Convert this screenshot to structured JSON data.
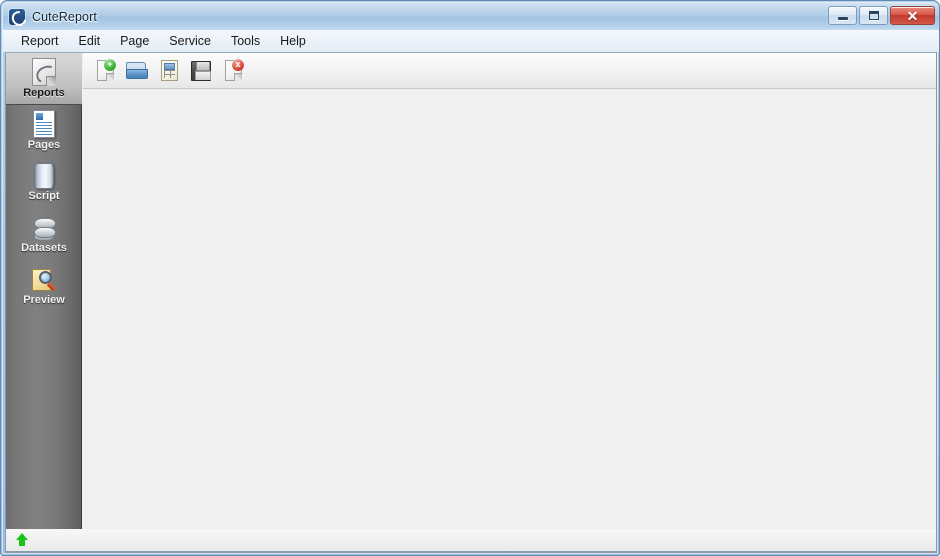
{
  "window": {
    "title": "CuteReport",
    "app_icon": "cutereport-logo-icon",
    "controls": {
      "minimize_label": "",
      "maximize_label": "",
      "close_label": "✕"
    }
  },
  "menu": {
    "items": [
      {
        "label": "Report"
      },
      {
        "label": "Edit"
      },
      {
        "label": "Page"
      },
      {
        "label": "Service"
      },
      {
        "label": "Tools"
      },
      {
        "label": "Help"
      }
    ]
  },
  "toolbar": {
    "buttons": [
      {
        "name": "new-report-button",
        "icon": "new-document-icon",
        "badge": "+"
      },
      {
        "name": "open-report-button",
        "icon": "open-folder-icon",
        "badge": ""
      },
      {
        "name": "save-as-report-button",
        "icon": "report-table-icon",
        "badge": ""
      },
      {
        "name": "save-report-button",
        "icon": "floppy-save-icon",
        "badge": ""
      },
      {
        "name": "close-report-button",
        "icon": "close-document-icon",
        "badge": "x"
      }
    ]
  },
  "sidebar": {
    "items": [
      {
        "label": "Reports",
        "icon": "reports-icon",
        "selected": true
      },
      {
        "label": "Pages",
        "icon": "pages-icon",
        "selected": false
      },
      {
        "label": "Script",
        "icon": "script-icon",
        "selected": false
      },
      {
        "label": "Datasets",
        "icon": "datasets-icon",
        "selected": false
      },
      {
        "label": "Preview",
        "icon": "preview-icon",
        "selected": false
      }
    ]
  },
  "content": {
    "empty_text": ""
  },
  "status_bar": {
    "icon": "green-up-arrow-icon",
    "text": ""
  },
  "colors": {
    "title_bar_blue": "#a2c3e2",
    "frame_blue": "#9dbfe0",
    "sidebar_grey": "#7b7b7b",
    "content_grey": "#f0f0f0",
    "close_red": "#c0392b",
    "status_green": "#19c219"
  }
}
